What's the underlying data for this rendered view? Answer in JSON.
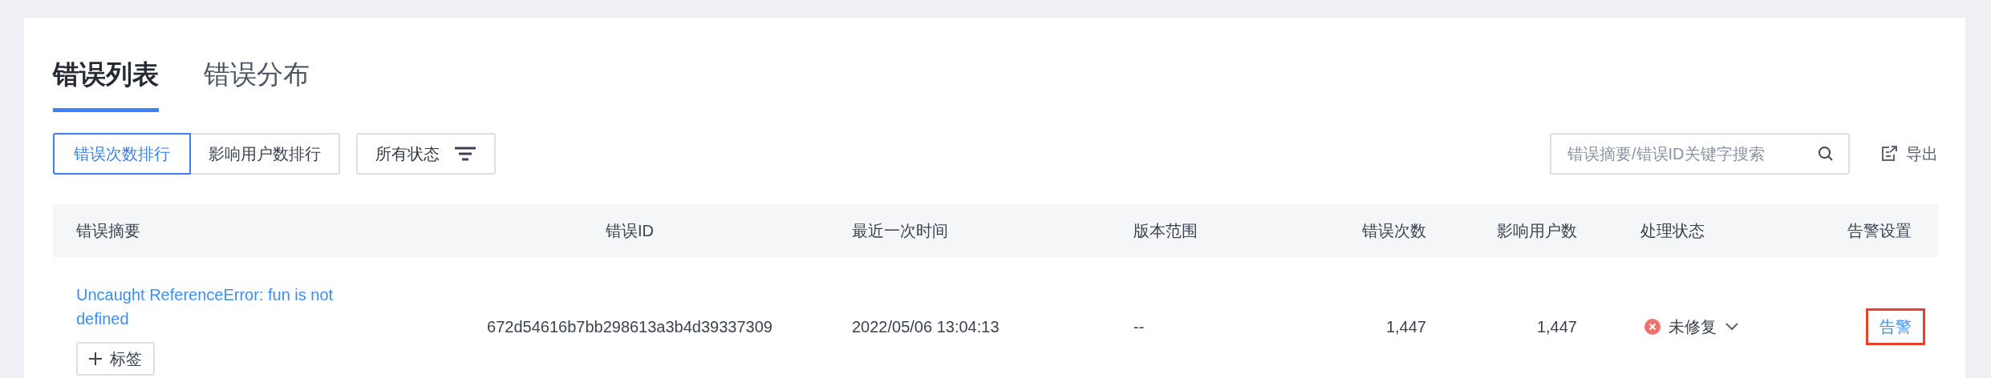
{
  "tabs": [
    {
      "label": "错误列表",
      "selected": true
    },
    {
      "label": "错误分布",
      "selected": false
    }
  ],
  "sort_buttons": [
    {
      "label": "错误次数排行",
      "selected": true
    },
    {
      "label": "影响用户数排行",
      "selected": false
    }
  ],
  "status_filter": {
    "label": "所有状态"
  },
  "search": {
    "placeholder": "错误摘要/错误ID关键字搜索"
  },
  "export": {
    "label": "导出"
  },
  "table": {
    "columns": [
      "错误摘要",
      "错误ID",
      "最近一次时间",
      "版本范围",
      "错误次数",
      "影响用户数",
      "处理状态",
      "告警设置"
    ],
    "rows": [
      {
        "summary": "Uncaught ReferenceError: fun is not defined",
        "tag_button": "标签",
        "id": "672d54616b7bb298613a3b4d39337309",
        "time": "2022/05/06 13:04:13",
        "version": "--",
        "errors": "1,447",
        "users": "1,447",
        "status": {
          "label": "未修复",
          "kind": "unfixed"
        },
        "alert": {
          "label": "告警",
          "highlighted": true
        }
      }
    ]
  }
}
